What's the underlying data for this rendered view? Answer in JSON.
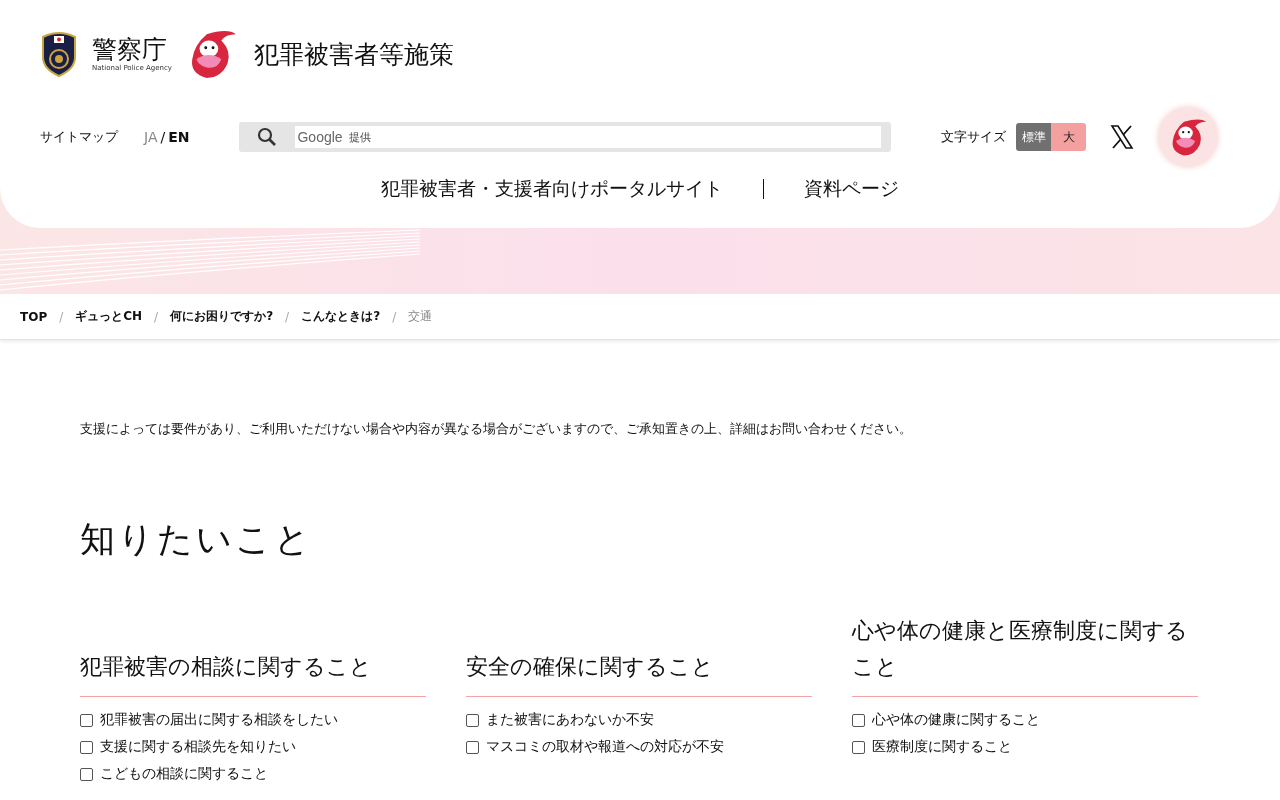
{
  "header": {
    "agency_name": "警察庁",
    "agency_name_en": "National Police Agency",
    "site_title": "犯罪被害者等施策",
    "sitemap_link": "サイトマップ",
    "languages": [
      {
        "label": "JA",
        "selected": false
      },
      {
        "label": "EN",
        "selected": true
      }
    ],
    "language_separator": "/",
    "search": {
      "placeholder_brand": "Google",
      "placeholder_note": "提供"
    },
    "text_size": {
      "label": "文字サイズ",
      "options": [
        {
          "label": "標準",
          "selected": true
        },
        {
          "label": "大",
          "selected": false
        }
      ]
    },
    "nav": [
      "犯罪被害者・支援者向けポータルサイト",
      "資料ページ"
    ]
  },
  "breadcrumb": [
    {
      "label": "TOP",
      "current": false
    },
    {
      "label": "ギュっとCH",
      "current": false
    },
    {
      "label": "何にお困りですか?",
      "current": false
    },
    {
      "label": "こんなときは?",
      "current": false
    },
    {
      "label": "交通",
      "current": true
    }
  ],
  "breadcrumb_separator": "/",
  "notice": "支援によっては要件があり、ご利用いただけない場合や内容が異なる場合がございますので、ご承知置きの上、詳細はお問い合わせください。",
  "section_title": "知りたいこと",
  "categories": [
    {
      "title": "犯罪被害の相談に関すること",
      "items": [
        {
          "label": "犯罪被害の届出に関する相談をしたい",
          "checked": false
        },
        {
          "label": "支援に関する相談先を知りたい",
          "checked": false
        },
        {
          "label": "こどもの相談に関すること",
          "checked": false
        }
      ]
    },
    {
      "title": "安全の確保に関すること",
      "items": [
        {
          "label": "また被害にあわないか不安",
          "checked": false
        },
        {
          "label": "マスコミの取材や報道への対応が不安",
          "checked": false
        }
      ]
    },
    {
      "title": "心や体の健康と医療制度に関すること",
      "items": [
        {
          "label": "心や体の健康に関すること",
          "checked": false
        },
        {
          "label": "医療制度に関すること",
          "checked": false
        }
      ]
    }
  ]
}
